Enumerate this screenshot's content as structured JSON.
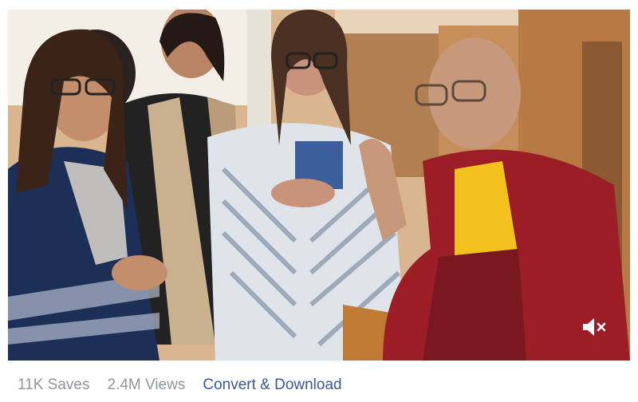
{
  "video": {
    "mute_icon": "speaker-muted-icon",
    "colors": {
      "wall": "#c9a27a",
      "robe_red": "#9b1d26",
      "robe_yellow": "#f2c11d",
      "navy_dress": "#1b2f57",
      "grey_stripe": "#b9c2cd"
    }
  },
  "stats": {
    "saves": "11K Saves",
    "views": "2.4M Views"
  },
  "actions": {
    "convert_download": "Convert & Download"
  },
  "colors": {
    "link": "#3b5998",
    "stat_text": "#8f969e"
  }
}
